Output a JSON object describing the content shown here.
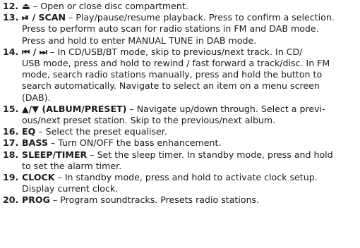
{
  "items": [
    {
      "num": "12.",
      "icon": "⏏",
      "icon_name": "eject-icon",
      "term": "",
      "sep": " – ",
      "lines": [
        "Open or close disc compartment."
      ]
    },
    {
      "num": "13.",
      "icon": "⏯",
      "icon_name": "play-pause-icon",
      "term": " / SCAN",
      "sep": " – ",
      "lines": [
        "Play/pause/resume playback. Press to confirm a selection.",
        "Press to perform auto scan for radio stations in FM and DAB mode.",
        "Press and hold to enter MANUAL TUNE in DAB mode."
      ]
    },
    {
      "num": "14.",
      "icon": "⏮ / ⏭",
      "icon_name": "skip-previous-next-icon",
      "term": "",
      "sep": " – ",
      "lines": [
        "In CD/USB/BT mode, skip to previous/next track. In CD/",
        "USB mode, press and hold to rewind / fast forward a track/disc. In FM",
        "mode, search radio stations manually, press and hold the button to",
        "search automatically. Navigate to select an item on a menu screen",
        "(DAB)."
      ]
    },
    {
      "num": "15.",
      "icon": "▲/▼",
      "icon_name": "up-down-arrow-icon",
      "term": " (ALBUM/PRESET)",
      "sep": " – ",
      "lines": [
        "Navigate up/down through. Select a previ-",
        "ous/next preset station. Skip to the previous/next album."
      ]
    },
    {
      "num": "16.",
      "icon": "",
      "icon_name": "",
      "term": "EQ",
      "sep": " – ",
      "lines": [
        "Select the preset equaliser."
      ]
    },
    {
      "num": "17.",
      "icon": "",
      "icon_name": "",
      "term": "BASS",
      "sep": " – ",
      "lines": [
        "Turn ON/OFF the bass enhancement."
      ]
    },
    {
      "num": "18.",
      "icon": "",
      "icon_name": "",
      "term": "SLEEP/TIMER",
      "sep": " – ",
      "lines": [
        "Set the sleep timer. In standby mode, press and hold",
        "to set the alarm timer."
      ]
    },
    {
      "num": "19.",
      "icon": "",
      "icon_name": "",
      "term": "CLOCK",
      "sep": " – ",
      "lines": [
        "In standby mode, press and hold to activate clock setup.",
        "Display current clock."
      ]
    },
    {
      "num": "20.",
      "icon": "",
      "icon_name": "",
      "term": "PROG",
      "sep": " – ",
      "lines": [
        "Program soundtracks. Presets radio stations."
      ]
    }
  ]
}
